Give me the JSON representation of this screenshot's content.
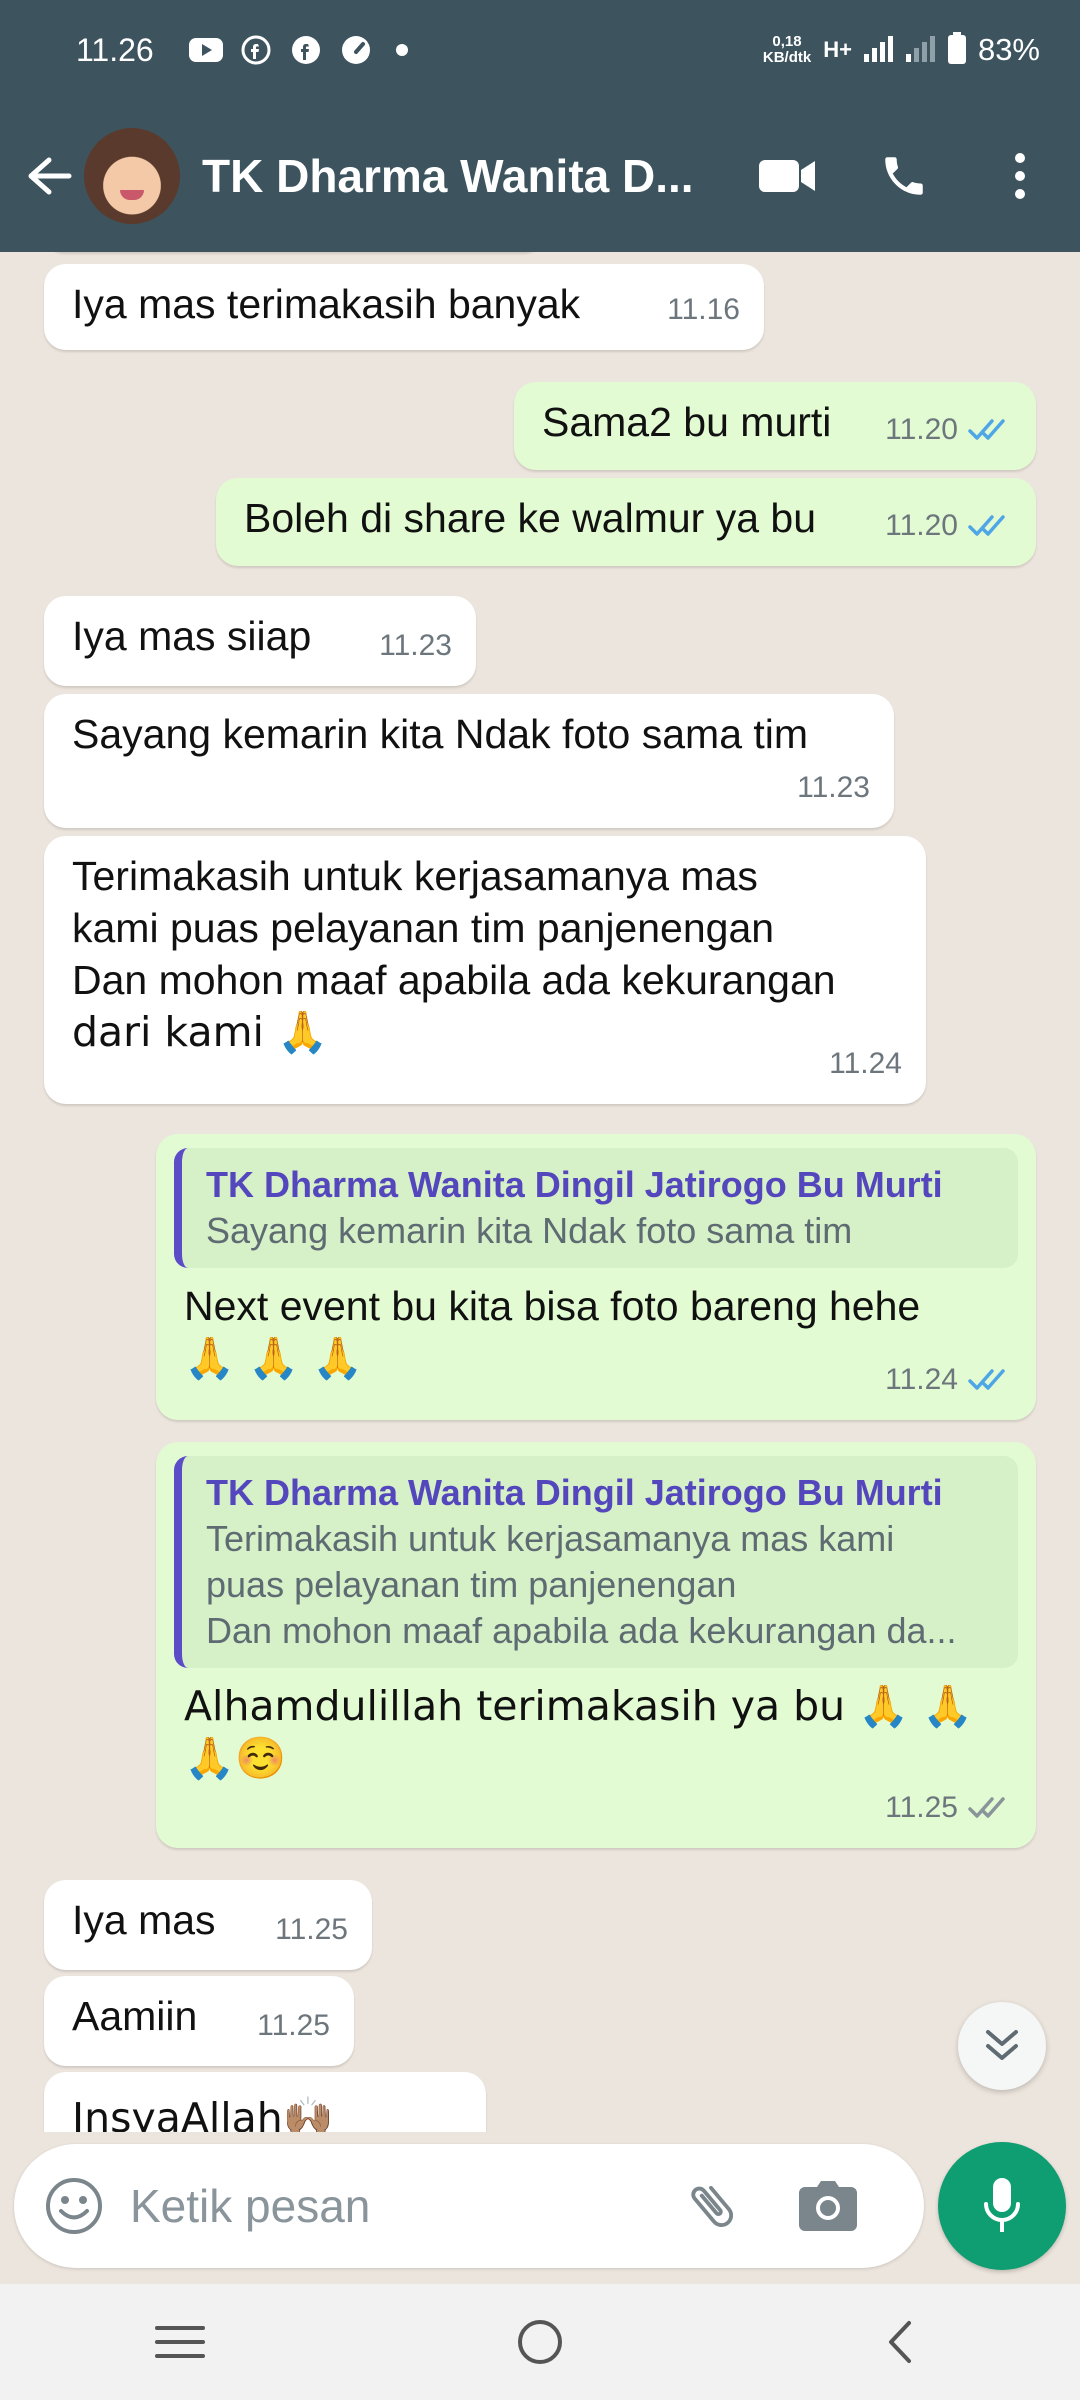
{
  "status_bar": {
    "time": "11.26",
    "net_speed_value": "0,18",
    "net_speed_unit": "KB/dtk",
    "network_type": "H+",
    "battery": "83%"
  },
  "header": {
    "title": "TK Dharma Wanita D..."
  },
  "messages": [
    {
      "dir": "in",
      "text": "Iya mas terimakasih banyak",
      "time": "11.16"
    },
    {
      "dir": "out",
      "text": "Sama2 bu murti",
      "time": "11.20",
      "status": "read"
    },
    {
      "dir": "out",
      "text": "Boleh di share ke walmur ya bu",
      "time": "11.20",
      "status": "read"
    },
    {
      "dir": "in",
      "text": "Iya mas siiap",
      "time": "11.23"
    },
    {
      "dir": "in",
      "text": "Sayang kemarin kita Ndak foto sama tim",
      "time": "11.23"
    },
    {
      "dir": "in",
      "text_lines": [
        "Terimakasih untuk kerjasamanya mas",
        "kami puas pelayanan tim panjenengan",
        "Dan mohon maaf apabila ada kekurangan",
        "dari kami 🙏"
      ],
      "time": "11.24"
    },
    {
      "dir": "out",
      "quote_author": "TK Dharma Wanita Dingil Jatirogo Bu Murti",
      "quote_lines": [
        "Sayang kemarin kita Ndak foto sama tim"
      ],
      "text_lines": [
        "Next event bu kita bisa foto bareng hehe",
        "🙏 🙏 🙏"
      ],
      "time": "11.24",
      "status": "read"
    },
    {
      "dir": "out",
      "quote_author": "TK Dharma Wanita Dingil Jatirogo Bu Murti",
      "quote_lines": [
        "Terimakasih untuk kerjasamanya mas kami",
        "puas pelayanan tim panjenengan",
        "Dan mohon maaf apabila ada kekurangan da..."
      ],
      "text_lines": [
        "Alhamdulillah terimakasih ya bu 🙏 🙏",
        "🙏☺️"
      ],
      "time": "11.25",
      "status": "delivered"
    },
    {
      "dir": "in",
      "text": "Iya mas",
      "time": "11.25"
    },
    {
      "dir": "in",
      "text": "Aamiin",
      "time": "11.25"
    },
    {
      "dir": "in",
      "text": "InsyaAllah🙌🏽",
      "time": ""
    }
  ],
  "composer": {
    "placeholder": "Ketik pesan"
  },
  "colors": {
    "header": "#3d545f",
    "incoming_bubble": "#ffffff",
    "outgoing_bubble": "#e2fbd3",
    "read_tick": "#4fa6e6",
    "accent": "#0f9d72",
    "quote_author": "#5446bc"
  }
}
